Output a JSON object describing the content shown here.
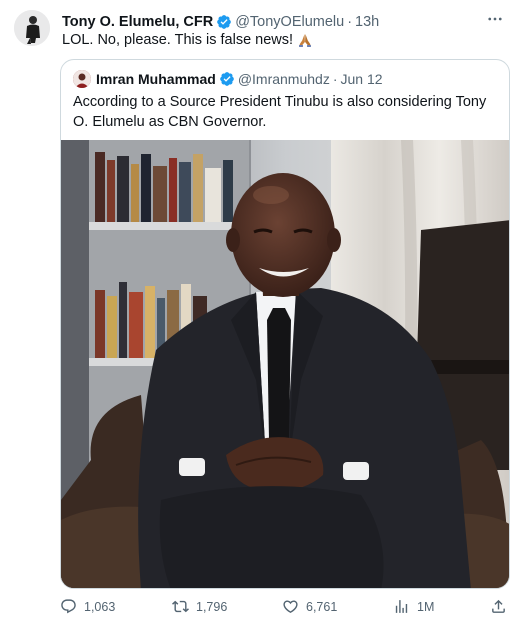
{
  "tweet": {
    "author_name": "Tony O. Elumelu, CFR",
    "author_handle": "@TonyOElumelu",
    "separator": "·",
    "time": "13h",
    "text": "LOL. No, please. This is false news!",
    "emoji": "folded-hands-emoji"
  },
  "quote": {
    "author_name": "Imran Muhammad",
    "author_handle": "@Imranmuhdz",
    "separator": "·",
    "date": "Jun 12",
    "text": "According to a Source President Tinubu is also considering Tony O. Elumelu as CBN Governor."
  },
  "actions": {
    "replies": "1,063",
    "reposts": "1,796",
    "likes": "6,761",
    "views": "1M"
  },
  "colors": {
    "verified": "#1d9bf0",
    "secondary_text": "#536471",
    "border": "#cfd9de"
  }
}
